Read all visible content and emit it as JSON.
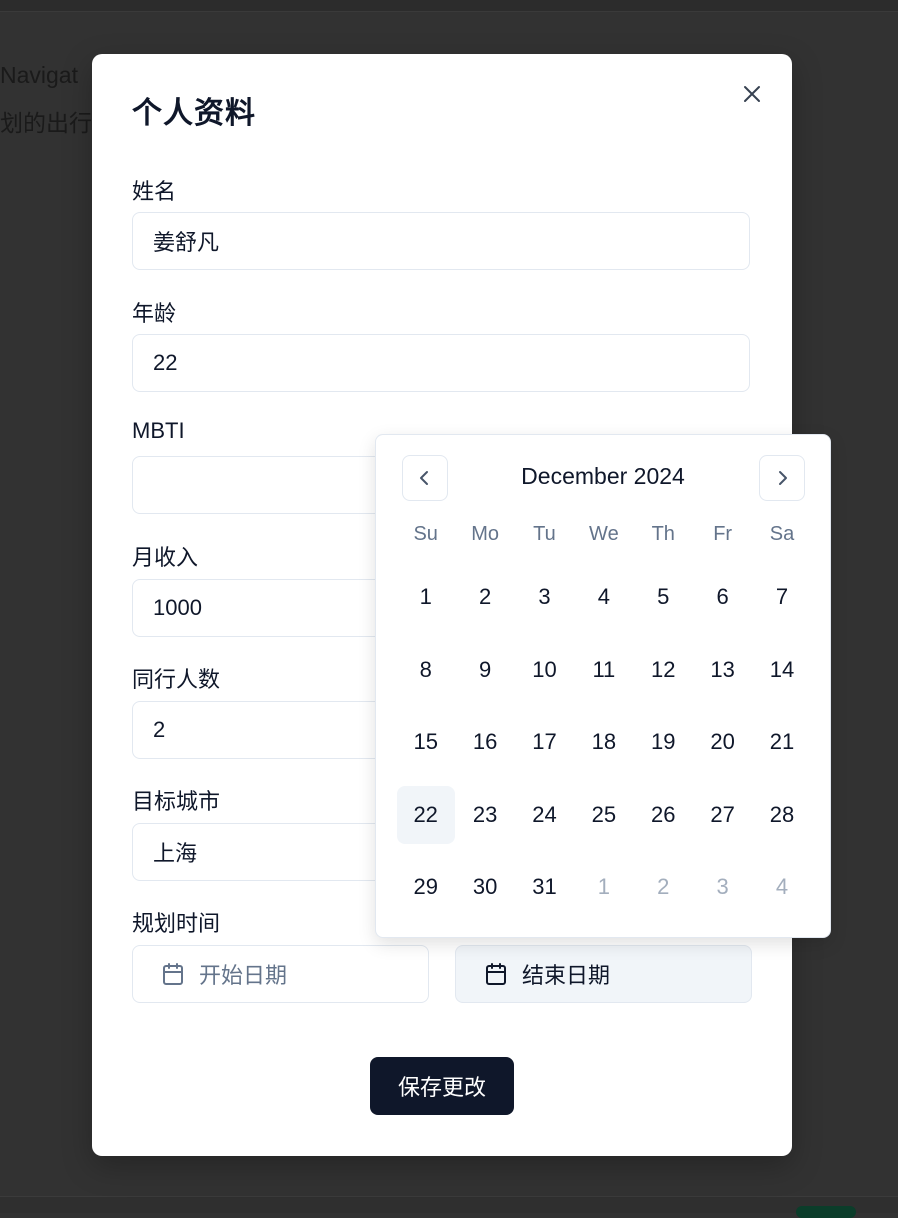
{
  "background": {
    "text_line1": "Navigat",
    "text_line2": "划的出行"
  },
  "dialog": {
    "title": "个人资料",
    "close_icon": "close-icon",
    "fields": {
      "name": {
        "label": "姓名",
        "value": "姜舒凡"
      },
      "age": {
        "label": "年龄",
        "value": "22"
      },
      "mbti": {
        "label": "MBTI",
        "value": ""
      },
      "income": {
        "label": "月收入",
        "value": "1000"
      },
      "companions": {
        "label": "同行人数",
        "value": "2"
      },
      "city": {
        "label": "目标城市",
        "value": "上海"
      },
      "plan_time": {
        "label": "规划时间",
        "start_placeholder": "开始日期",
        "end_placeholder": "结束日期"
      }
    },
    "save_label": "保存更改"
  },
  "calendar": {
    "month_label": "December 2024",
    "prev_icon": "chevron-left-icon",
    "next_icon": "chevron-right-icon",
    "weekdays": [
      "Su",
      "Mo",
      "Tu",
      "We",
      "Th",
      "Fr",
      "Sa"
    ],
    "days": [
      "1",
      "2",
      "3",
      "4",
      "5",
      "6",
      "7",
      "8",
      "9",
      "10",
      "11",
      "12",
      "13",
      "14",
      "15",
      "16",
      "17",
      "18",
      "19",
      "20",
      "21",
      "22",
      "23",
      "24",
      "25",
      "26",
      "27",
      "28",
      "29",
      "30",
      "31",
      "1",
      "2",
      "3",
      "4"
    ],
    "outside_from_index": 31,
    "today_index": 21
  },
  "colors": {
    "primary": "#0f172a",
    "muted": "#64748b",
    "highlight": "#f1f5f9",
    "border": "#e2e8f0"
  }
}
